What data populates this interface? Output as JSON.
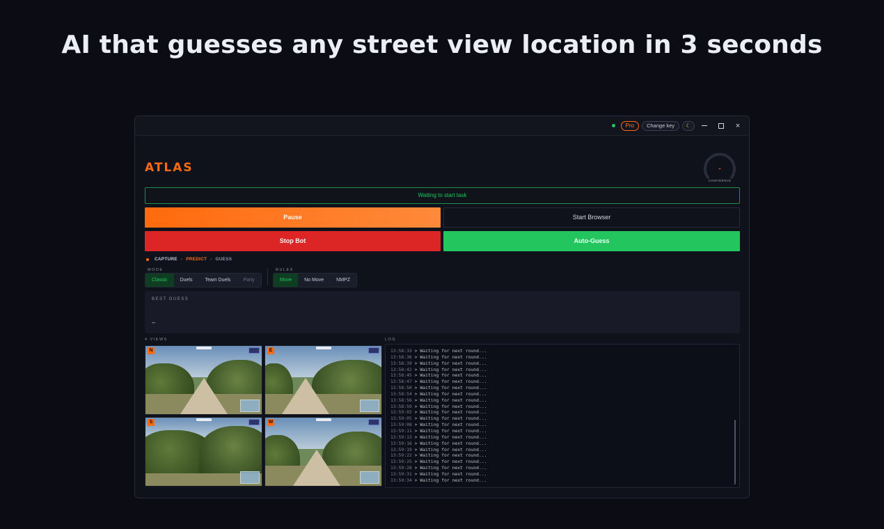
{
  "page": {
    "headline": "AI that guesses any street view location in 3 seconds"
  },
  "titlebar": {
    "pro_label": "Pro",
    "change_key_label": "Change key",
    "theme_icon": "moon-icon",
    "minimize_icon": "minimize-icon",
    "maximize_icon": "maximize-icon",
    "close_label": "×"
  },
  "app": {
    "logo": "ATLAS",
    "confidence": {
      "value": "-",
      "label": "CONFIDENCE"
    },
    "status_text": "Waiting to start task",
    "buttons": {
      "pause": "Pause",
      "start_browser": "Start Browser",
      "stop_bot": "Stop Bot",
      "auto_guess": "Auto-Guess"
    },
    "pipeline": {
      "steps": [
        "CAPTURE",
        "PREDICT",
        "GUESS"
      ],
      "separator": "›",
      "active_step": "PREDICT"
    },
    "mode": {
      "label": "MODE",
      "options": [
        "Classic",
        "Duels",
        "Team Duels",
        "Party"
      ],
      "selected": "Classic"
    },
    "rules": {
      "label": "RULES",
      "options": [
        "Move",
        "No Move",
        "NMPZ"
      ],
      "selected": "Move"
    },
    "best_guess": {
      "label": "BEST GUESS",
      "value": "–"
    },
    "views": {
      "label": "4 VIEWS",
      "items": [
        {
          "direction": "N"
        },
        {
          "direction": "E"
        },
        {
          "direction": "S"
        },
        {
          "direction": "W"
        }
      ]
    },
    "log": {
      "label": "LOG",
      "message": "> Waiting for next round...",
      "timestamps": [
        "13:58:33",
        "13:58:36",
        "13:58:39",
        "13:58:42",
        "13:58:45",
        "13:58:47",
        "13:58:50",
        "13:58:54",
        "13:58:56",
        "13:58:59",
        "13:59:02",
        "13:59:05",
        "13:59:08",
        "13:59:11",
        "13:59:13",
        "13:59:16",
        "13:59:19",
        "13:59:22",
        "13:59:25",
        "13:59:28",
        "13:59:31",
        "13:59:34"
      ]
    }
  },
  "colors": {
    "accent": "#ff6a13",
    "success": "#22c55e",
    "danger": "#dc2626",
    "background": "#0b0c14"
  }
}
